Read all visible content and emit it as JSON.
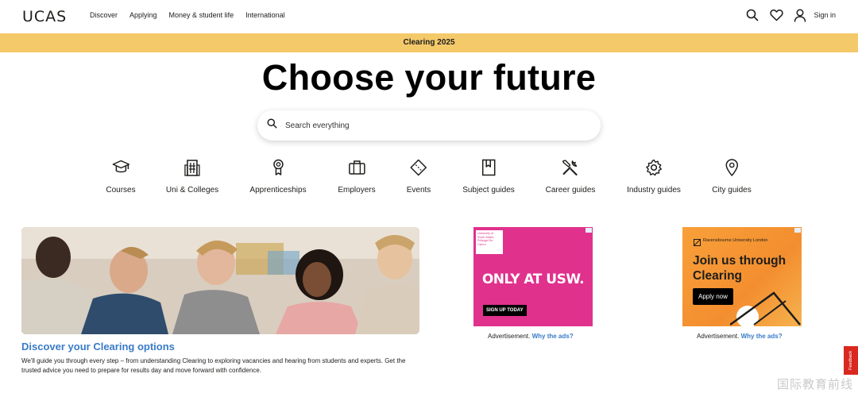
{
  "header": {
    "logo": "UCAS",
    "nav": [
      "Discover",
      "Applying",
      "Money & student life",
      "International"
    ],
    "sign_in": "Sign in",
    "icons": [
      "search-icon",
      "heart-icon",
      "user-icon"
    ]
  },
  "banner": {
    "text": "Clearing 2025",
    "color": "#f4c96a"
  },
  "hero": {
    "title": "Choose your future",
    "search_placeholder": "Search everything"
  },
  "categories": [
    {
      "label": "Courses",
      "icon": "graduation-cap-icon"
    },
    {
      "label": "Uni & Colleges",
      "icon": "building-icon"
    },
    {
      "label": "Apprenticeships",
      "icon": "award-icon"
    },
    {
      "label": "Employers",
      "icon": "briefcase-icon"
    },
    {
      "label": "Events",
      "icon": "ticket-icon"
    },
    {
      "label": "Subject guides",
      "icon": "bookmark-icon"
    },
    {
      "label": "Career guides",
      "icon": "tools-icon"
    },
    {
      "label": "Industry guides",
      "icon": "gear-icon"
    },
    {
      "label": "City guides",
      "icon": "map-pin-icon"
    }
  ],
  "feature": {
    "title": "Discover your Clearing options",
    "text": "We'll guide you through every step – from understanding Clearing to exploring vacancies and hearing from students and experts. Get the trusted advice you need to prepare for results day and move forward with confidence."
  },
  "ads": [
    {
      "logo_text": "University of South Wales Prifysgol De Cymru",
      "headline": "ONLY AT USW.",
      "cta": "SIGN UP TODAY",
      "caption": "Advertisement.",
      "why": "Why the ads?",
      "color": "#e0318d"
    },
    {
      "logo_text": "Ravensbourne University London",
      "headline": "Join us through Clearing",
      "cta": "Apply now",
      "caption": "Advertisement.",
      "why": "Why the ads?",
      "color": "#f38e2f"
    }
  ],
  "feedback": "Feedback",
  "watermark": "国际教育前线",
  "accent_color": "#3a7bc8"
}
